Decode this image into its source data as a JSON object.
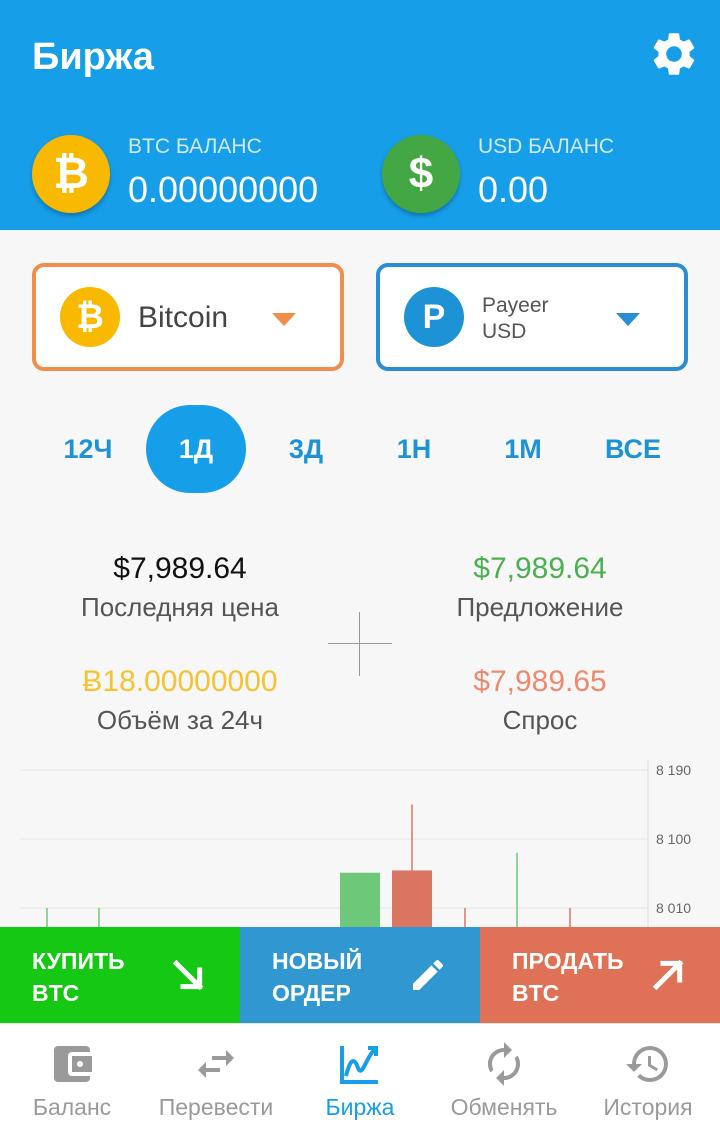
{
  "header": {
    "title": "Биржа",
    "settings_icon": "gear-icon",
    "balances": [
      {
        "label": "BTC БАЛАНС",
        "value": "0.00000000",
        "icon": "bitcoin-icon",
        "color": "#f8b900"
      },
      {
        "label": "USD БАЛАНС",
        "value": "0.00",
        "icon": "dollar-icon",
        "color": "#43a843"
      }
    ]
  },
  "selectors": {
    "base": {
      "label": "Bitcoin",
      "icon": "bitcoin-icon",
      "border_color": "#f28d4a"
    },
    "quote": {
      "line1": "Payeer",
      "line2": "USD",
      "icon": "payeer-icon",
      "border_color": "#2a8ed4"
    }
  },
  "periods": {
    "items": [
      "12Ч",
      "1Д",
      "3Д",
      "1Н",
      "1М",
      "ВСЕ"
    ],
    "active": "1Д"
  },
  "stats": {
    "last_price": {
      "value": "$7,989.64",
      "label": "Последняя цена"
    },
    "bid": {
      "value": "$7,989.64",
      "label": "Предложение"
    },
    "volume": {
      "value": "Ƀ18.00000000",
      "label": "Объём за 24ч"
    },
    "ask": {
      "value": "$7,989.65",
      "label": "Спрос"
    }
  },
  "chart_data": {
    "type": "candlestick",
    "y_ticks": [
      "8 190",
      "8 100",
      "8 010"
    ],
    "ylim": [
      7990,
      8190
    ],
    "candles": [
      {
        "open": 8006,
        "high": 8010,
        "low": 7990,
        "close": 8003,
        "direction": "up"
      },
      {
        "open": 8006,
        "high": 8010,
        "low": 7990,
        "close": 8003,
        "direction": "up"
      },
      {
        "open": 7990,
        "high": 8056,
        "low": 7990,
        "close": 8056,
        "direction": "up"
      },
      {
        "open": 8059,
        "high": 8145,
        "low": 7990,
        "close": 7990,
        "direction": "down"
      },
      {
        "open": 8006,
        "high": 8010,
        "low": 7990,
        "close": 8003,
        "direction": "down"
      },
      {
        "open": 8006,
        "high": 8082,
        "low": 7990,
        "close": 8003,
        "direction": "up"
      },
      {
        "open": 8006,
        "high": 8010,
        "low": 7990,
        "close": 8003,
        "direction": "down"
      }
    ],
    "colors": {
      "up": "#6dc87a",
      "down": "#d97560"
    },
    "grid": true
  },
  "actions": [
    {
      "label": "КУПИТЬ BTC",
      "icon": "arrow-down-right-icon",
      "color": "#14c814"
    },
    {
      "label": "НОВЫЙ ОРДЕР",
      "icon": "pencil-icon",
      "color": "#3197d0"
    },
    {
      "label": "ПРОДАТЬ BTC",
      "icon": "arrow-up-right-icon",
      "color": "#df7256"
    }
  ],
  "nav": {
    "items": [
      {
        "label": "Баланс",
        "icon": "wallet-icon"
      },
      {
        "label": "Перевести",
        "icon": "transfer-icon"
      },
      {
        "label": "Биржа",
        "icon": "chart-icon"
      },
      {
        "label": "Обменять",
        "icon": "exchange-icon"
      },
      {
        "label": "История",
        "icon": "history-icon"
      }
    ],
    "active": "Биржа"
  }
}
